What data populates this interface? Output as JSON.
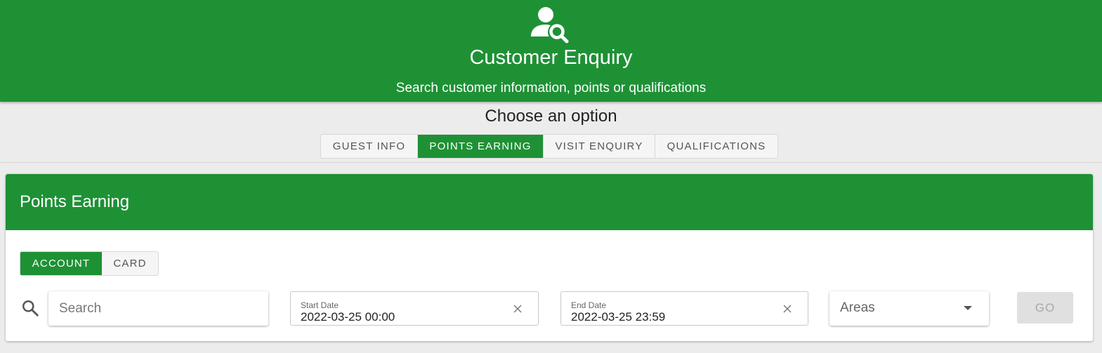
{
  "header": {
    "icon": "person-search-icon",
    "title": "Customer Enquiry",
    "subtitle": "Search customer information, points or qualifications"
  },
  "options": {
    "heading": "Choose an option",
    "tabs": [
      {
        "label": "GUEST INFO",
        "active": false
      },
      {
        "label": "POINTS EARNING",
        "active": true
      },
      {
        "label": "VISIT ENQUIRY",
        "active": false
      },
      {
        "label": "QUALIFICATIONS",
        "active": false
      }
    ]
  },
  "panel": {
    "title": "Points Earning",
    "mode_toggle": [
      {
        "label": "ACCOUNT",
        "active": true
      },
      {
        "label": "CARD",
        "active": false
      }
    ],
    "search": {
      "icon": "search-icon",
      "placeholder": "Search",
      "value": ""
    },
    "start_date": {
      "label": "Start Date",
      "value": "2022-03-25 00:00",
      "clear_icon": "close-icon"
    },
    "end_date": {
      "label": "End Date",
      "value": "2022-03-25 23:59",
      "clear_icon": "close-icon"
    },
    "areas": {
      "placeholder": "Areas",
      "icon": "caret-down-icon"
    },
    "go_label": "GO",
    "go_enabled": false
  },
  "colors": {
    "primary": "#1e9135",
    "background": "#ececec",
    "disabled_button": "#e0e0e0"
  }
}
